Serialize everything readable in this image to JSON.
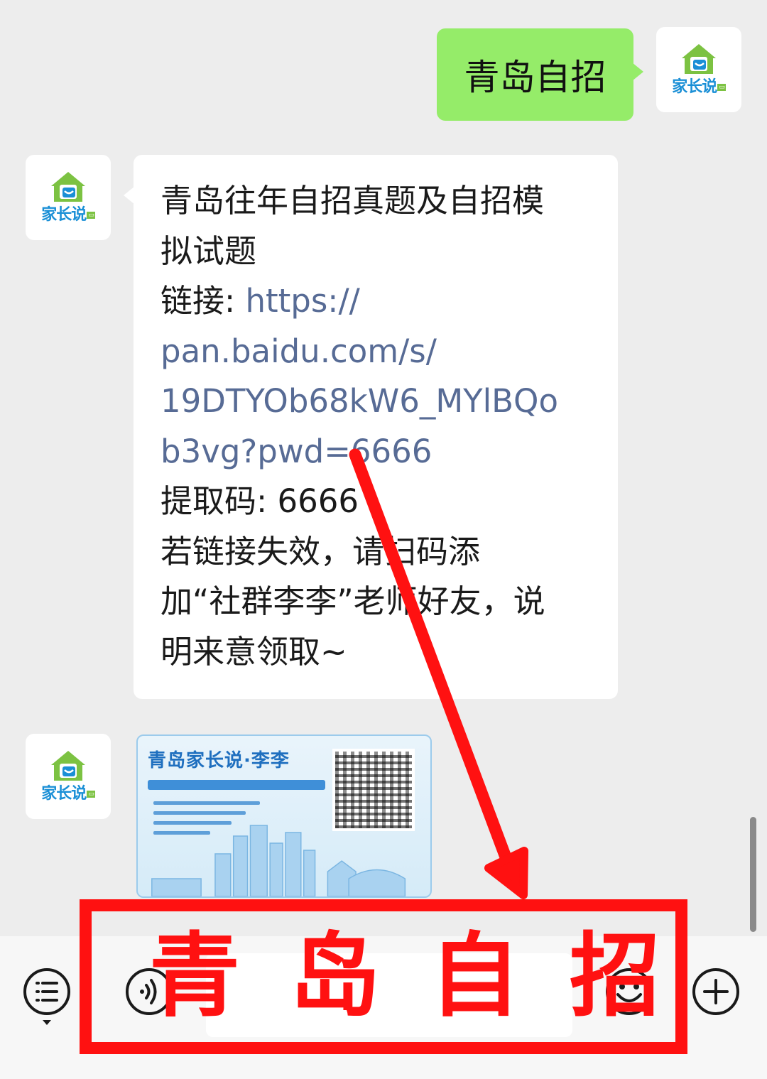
{
  "chat": {
    "outgoing": {
      "text": "青岛自招"
    },
    "incoming": {
      "lines": [
        {
          "text": "青岛往年自招真题及自招模",
          "link": ""
        },
        {
          "text": "拟试题",
          "link": ""
        },
        {
          "text": "链接: ",
          "link": "https://"
        },
        {
          "text": "",
          "link": "pan.baidu.com/s/"
        },
        {
          "text": "",
          "link": "19DTYOb68kW6_MYlBQo"
        },
        {
          "text": "",
          "link": "b3vg?pwd=6666"
        },
        {
          "text": "提取码: 6666",
          "link": ""
        },
        {
          "text": "若链接失效，请扫码添",
          "link": ""
        },
        {
          "text": "加“社群李李”老师好友，说",
          "link": ""
        },
        {
          "text": "明来意领取~",
          "link": ""
        }
      ]
    },
    "image_card": {
      "title": "青岛家长说·李李"
    }
  },
  "avatar": {
    "brand": "家长说",
    "tag": "▭"
  },
  "overlay": {
    "chars": [
      "青",
      "岛",
      "自",
      "招"
    ]
  },
  "icons": {
    "menu": "list-menu-icon",
    "voice": "voice-icon",
    "emoji": "emoji-icon",
    "add": "plus-icon"
  },
  "colors": {
    "outgoing_bubble": "#95ec69",
    "link": "#576b95",
    "highlight": "#ff1111"
  }
}
